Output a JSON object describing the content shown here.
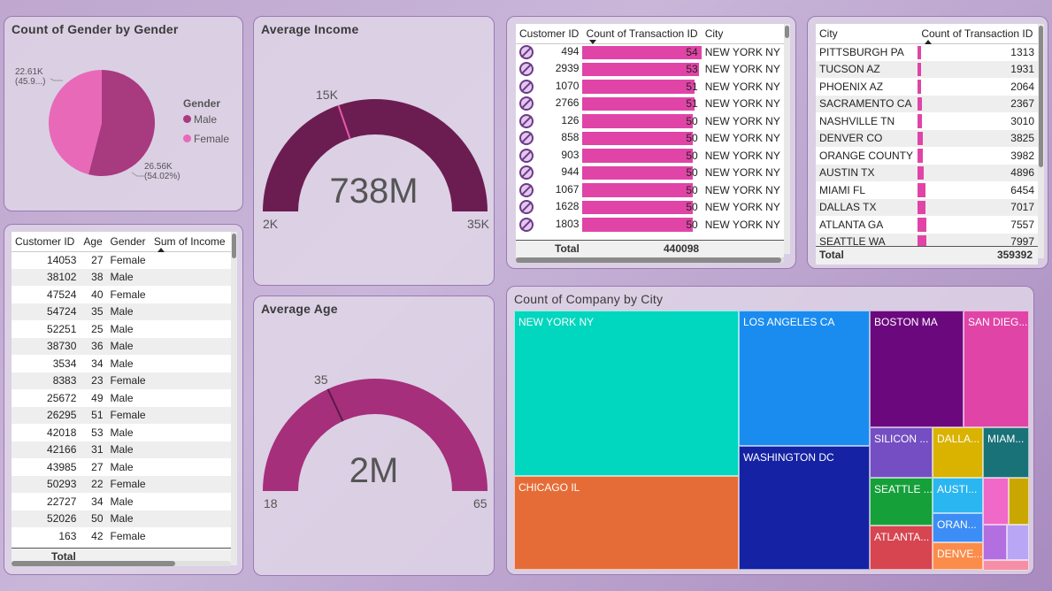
{
  "gender_pie": {
    "title": "Count of Gender by Gender",
    "legend_title": "Gender",
    "label_female": "22.61K",
    "label_female_pct": "(45.9...)",
    "label_male": "26.56K",
    "label_male_pct": "(54.02%)",
    "colors": {
      "Male": "#a83a80",
      "Female": "#e869b8"
    }
  },
  "chart_data": [
    {
      "type": "pie",
      "title": "Count of Gender by Gender",
      "legend_title": "Gender",
      "categories": [
        "Male",
        "Female"
      ],
      "values": [
        26560,
        22610
      ],
      "percent": [
        54.02,
        45.9
      ]
    },
    {
      "type": "gauge",
      "title": "Average Income",
      "value_label": "738M",
      "min": 2000,
      "max": 35000,
      "target": 15000,
      "min_label": "2K",
      "max_label": "35K",
      "target_label": "15K"
    },
    {
      "type": "gauge",
      "title": "Average Age",
      "value_label": "2M",
      "min": 18,
      "max": 65,
      "target": 35,
      "min_label": "18",
      "max_label": "65",
      "target_label": "35"
    },
    {
      "type": "treemap",
      "title": "Count of Company by City",
      "categories": [
        "NEW YORK NY",
        "LOS ANGELES CA",
        "BOSTON MA",
        "SAN DIEG...",
        "CHICAGO IL",
        "WASHINGTON DC",
        "SILICON ...",
        "DALLA...",
        "MIAM...",
        "SEATTLE ...",
        "AUSTI...",
        "ORAN...",
        "ATLANTA...",
        "DENVE..."
      ]
    }
  ],
  "income_gauge": {
    "title": "Average Income",
    "value": "738M",
    "min": "2K",
    "max": "35K",
    "target": "15K"
  },
  "age_gauge": {
    "title": "Average Age",
    "value": "2M",
    "min": "18",
    "max": "65",
    "target": "35"
  },
  "customer_table": {
    "headers": [
      "Customer ID",
      "Age",
      "Gender",
      "Sum of Income"
    ],
    "rows": [
      [
        "14053",
        "27",
        "Female"
      ],
      [
        "38102",
        "38",
        "Male"
      ],
      [
        "47524",
        "40",
        "Female"
      ],
      [
        "54724",
        "35",
        "Male"
      ],
      [
        "52251",
        "25",
        "Male"
      ],
      [
        "38730",
        "36",
        "Male"
      ],
      [
        "3534",
        "34",
        "Male"
      ],
      [
        "8383",
        "23",
        "Female"
      ],
      [
        "25672",
        "49",
        "Male"
      ],
      [
        "26295",
        "51",
        "Female"
      ],
      [
        "42018",
        "53",
        "Male"
      ],
      [
        "42166",
        "31",
        "Male"
      ],
      [
        "43985",
        "27",
        "Male"
      ],
      [
        "50293",
        "22",
        "Female"
      ],
      [
        "22727",
        "34",
        "Male"
      ],
      [
        "52026",
        "50",
        "Male"
      ],
      [
        "163",
        "42",
        "Female"
      ]
    ],
    "total_label": "Total"
  },
  "transaction_table": {
    "headers": [
      "Customer ID",
      "Count of Transaction ID",
      "City"
    ],
    "rows": [
      [
        "494",
        "54",
        "NEW YORK NY"
      ],
      [
        "2939",
        "53",
        "NEW YORK NY"
      ],
      [
        "1070",
        "51",
        "NEW YORK NY"
      ],
      [
        "2766",
        "51",
        "NEW YORK NY"
      ],
      [
        "126",
        "50",
        "NEW YORK NY"
      ],
      [
        "858",
        "50",
        "NEW YORK NY"
      ],
      [
        "903",
        "50",
        "NEW YORK NY"
      ],
      [
        "944",
        "50",
        "NEW YORK NY"
      ],
      [
        "1067",
        "50",
        "NEW YORK NY"
      ],
      [
        "1628",
        "50",
        "NEW YORK NY"
      ],
      [
        "1803",
        "50",
        "NEW YORK NY"
      ]
    ],
    "total_label": "Total",
    "total_value": "440098"
  },
  "city_table": {
    "headers": [
      "City",
      "Count of Transaction ID"
    ],
    "rows": [
      [
        "PITTSBURGH PA",
        "1313"
      ],
      [
        "TUCSON AZ",
        "1931"
      ],
      [
        "PHOENIX AZ",
        "2064"
      ],
      [
        "SACRAMENTO CA",
        "2367"
      ],
      [
        "NASHVILLE TN",
        "3010"
      ],
      [
        "DENVER CO",
        "3825"
      ],
      [
        "ORANGE COUNTY",
        "3982"
      ],
      [
        "AUSTIN TX",
        "4896"
      ],
      [
        "MIAMI FL",
        "6454"
      ],
      [
        "DALLAS TX",
        "7017"
      ],
      [
        "ATLANTA GA",
        "7557"
      ],
      [
        "SEATTLE WA",
        "7997"
      ]
    ],
    "total_label": "Total",
    "total_value": "359392"
  },
  "treemap": {
    "title": "Count of Company by City",
    "labels": {
      "newyork": "NEW YORK NY",
      "losangeles": "LOS ANGELES CA",
      "boston": "BOSTON MA",
      "sandiego": "SAN DIEG...",
      "chicago": "CHICAGO IL",
      "washington": "WASHINGTON DC",
      "silicon": "SILICON ...",
      "dallas": "DALLA...",
      "miami": "MIAM...",
      "seattle": "SEATTLE ...",
      "austin": "AUSTI...",
      "orange": "ORAN...",
      "atlanta": "ATLANTA...",
      "denver": "DENVE..."
    },
    "colors": {
      "newyork": "#01d6be",
      "losangeles": "#1a8cf0",
      "boston": "#6b087e",
      "sandiego": "#e044a7",
      "chicago": "#e66c37",
      "washington": "#1422a3",
      "silicon": "#744ec2",
      "dallas": "#d9b300",
      "miami": "#197278",
      "seattle": "#15a03a",
      "austin": "#2ab6f0",
      "orange": "#3c8df5",
      "atlanta": "#d64550",
      "denver": "#fb8c4a",
      "s1": "#f068c8",
      "s2": "#c9a700",
      "s3": "#b36ee0",
      "s4": "#b9a6f5",
      "s5": "#f58fa8"
    }
  }
}
